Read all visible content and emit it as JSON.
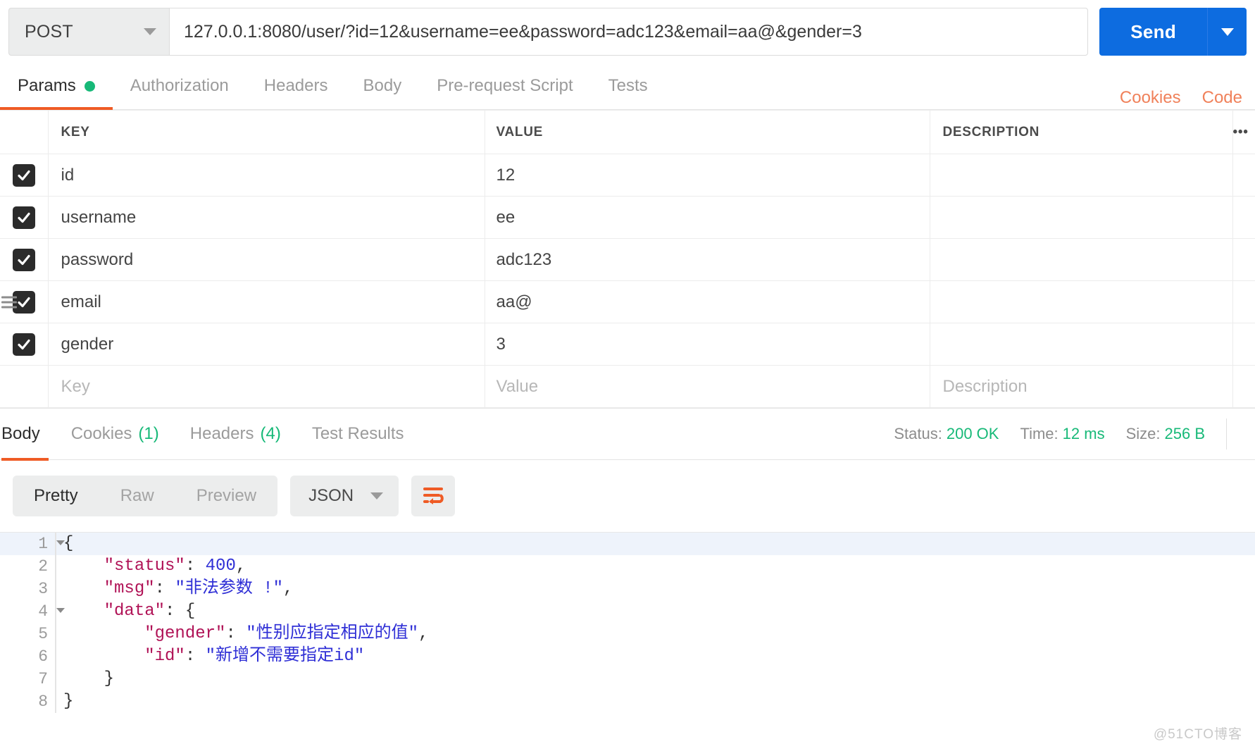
{
  "request": {
    "method": "POST",
    "method_caret_icon": "chevron-down-icon",
    "url": "127.0.0.1:8080/user/?id=12&username=ee&password=adc123&email=aa@&gender=3",
    "url_placeholder": "Enter request URL",
    "send_label": "Send",
    "send_caret_icon": "chevron-down-icon",
    "tabs": [
      {
        "label": "Params",
        "active": true,
        "has_dot": true
      },
      {
        "label": "Authorization",
        "active": false,
        "has_dot": false
      },
      {
        "label": "Headers",
        "active": false,
        "has_dot": false
      },
      {
        "label": "Body",
        "active": false,
        "has_dot": false
      },
      {
        "label": "Pre-request Script",
        "active": false,
        "has_dot": false
      },
      {
        "label": "Tests",
        "active": false,
        "has_dot": false
      }
    ],
    "cookies_link": "Cookies",
    "code_link": "Code"
  },
  "params_table": {
    "headers": {
      "key": "KEY",
      "value": "VALUE",
      "description": "DESCRIPTION",
      "more": "•••"
    },
    "rows": [
      {
        "checked": true,
        "key": "id",
        "value": "12",
        "description": "",
        "drag": false
      },
      {
        "checked": true,
        "key": "username",
        "value": "ee",
        "description": "",
        "drag": false
      },
      {
        "checked": true,
        "key": "password",
        "value": "adc123",
        "description": "",
        "drag": false
      },
      {
        "checked": true,
        "key": "email",
        "value": "aa@",
        "description": "",
        "drag": true
      },
      {
        "checked": true,
        "key": "gender",
        "value": "3",
        "description": "",
        "drag": false
      }
    ],
    "placeholder_row": {
      "key": "Key",
      "value": "Value",
      "description": "Description"
    }
  },
  "response": {
    "tabs": [
      {
        "label": "Body",
        "count": "",
        "active": true
      },
      {
        "label": "Cookies",
        "count": "(1)",
        "active": false
      },
      {
        "label": "Headers",
        "count": "(4)",
        "active": false
      },
      {
        "label": "Test Results",
        "count": "",
        "active": false
      }
    ],
    "status_label": "Status:",
    "status_value": "200 OK",
    "time_label": "Time:",
    "time_value": "12 ms",
    "size_label": "Size:",
    "size_value": "256 B",
    "view_modes": [
      {
        "label": "Pretty",
        "active": true
      },
      {
        "label": "Raw",
        "active": false
      },
      {
        "label": "Preview",
        "active": false
      }
    ],
    "format": "JSON",
    "format_caret_icon": "chevron-down-icon",
    "wrap_icon": "word-wrap-icon",
    "body_lines": [
      {
        "num": "1",
        "fold": true,
        "indent": 0,
        "tokens": [
          {
            "t": "p",
            "v": "{"
          }
        ]
      },
      {
        "num": "2",
        "fold": false,
        "indent": 1,
        "tokens": [
          {
            "t": "k",
            "v": "\"status\""
          },
          {
            "t": "p",
            "v": ": "
          },
          {
            "t": "n",
            "v": "400"
          },
          {
            "t": "p",
            "v": ","
          }
        ]
      },
      {
        "num": "3",
        "fold": false,
        "indent": 1,
        "tokens": [
          {
            "t": "k",
            "v": "\"msg\""
          },
          {
            "t": "p",
            "v": ": "
          },
          {
            "t": "s",
            "v": "\"非法参数 !\""
          },
          {
            "t": "p",
            "v": ","
          }
        ]
      },
      {
        "num": "4",
        "fold": true,
        "indent": 1,
        "tokens": [
          {
            "t": "k",
            "v": "\"data\""
          },
          {
            "t": "p",
            "v": ": {"
          }
        ]
      },
      {
        "num": "5",
        "fold": false,
        "indent": 2,
        "tokens": [
          {
            "t": "k",
            "v": "\"gender\""
          },
          {
            "t": "p",
            "v": ": "
          },
          {
            "t": "s",
            "v": "\"性别应指定相应的值\""
          },
          {
            "t": "p",
            "v": ","
          }
        ]
      },
      {
        "num": "6",
        "fold": false,
        "indent": 2,
        "tokens": [
          {
            "t": "k",
            "v": "\"id\""
          },
          {
            "t": "p",
            "v": ": "
          },
          {
            "t": "s",
            "v": "\"新增不需要指定id\""
          }
        ]
      },
      {
        "num": "7",
        "fold": false,
        "indent": 1,
        "tokens": [
          {
            "t": "p",
            "v": "}"
          }
        ]
      },
      {
        "num": "8",
        "fold": false,
        "indent": 0,
        "tokens": [
          {
            "t": "p",
            "v": "}"
          }
        ]
      }
    ]
  },
  "watermark": "@51CTO博客",
  "colors": {
    "accent_orange": "#ef5b25",
    "send_blue": "#0d6ce0",
    "status_green": "#17b978",
    "json_key": "#b01256",
    "json_value": "#2f2fd6"
  }
}
